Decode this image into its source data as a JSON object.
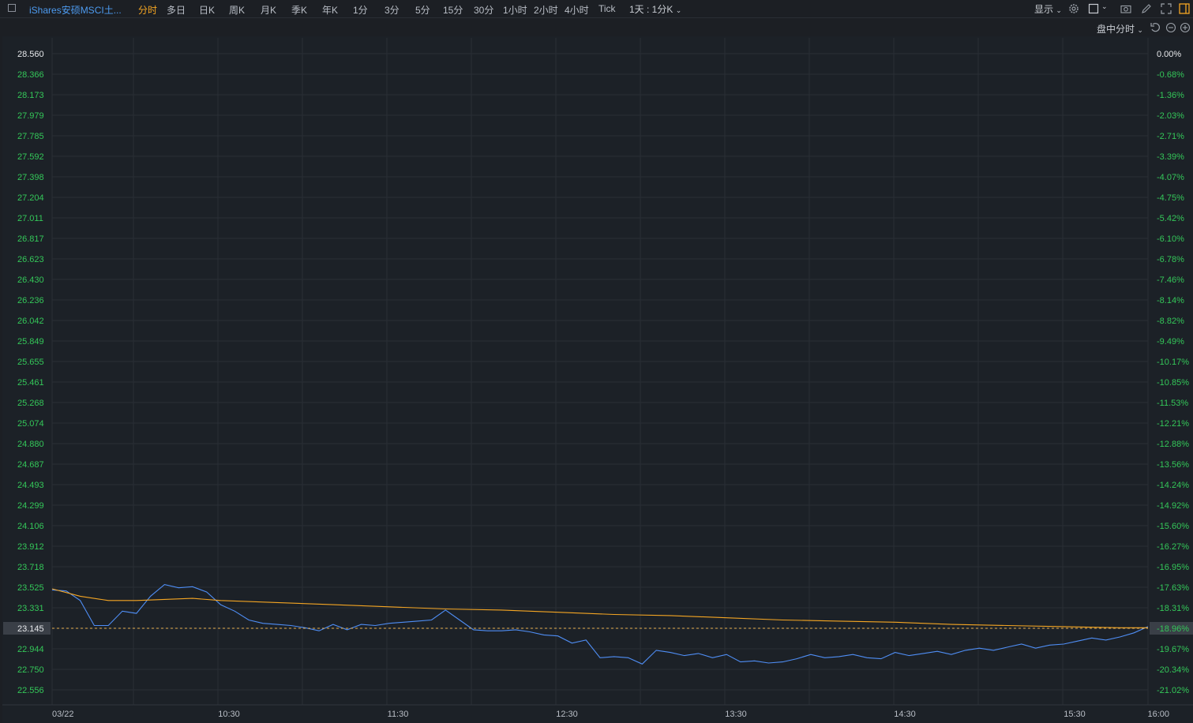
{
  "toolbar": {
    "title": "iShares安硕MSCI土...",
    "timeframes": [
      "分时",
      "多日",
      "日K",
      "周K",
      "月K",
      "季K",
      "年K",
      "1分",
      "3分",
      "5分",
      "15分",
      "30分",
      "1小时",
      "2小时",
      "4小时",
      "Tick"
    ],
    "active_timeframe": "分时",
    "period_select": "1天 : 1分K",
    "display_label": "显示",
    "session_label": "盘中分时"
  },
  "colors": {
    "price_line": "#4f8ef5",
    "avg_line": "#f5a623",
    "left_axis_text": "#34c759",
    "pct_text": "#34c759",
    "current_tag_bg": "#3a3f47",
    "grid": "#2a2e35"
  },
  "chart_data": {
    "type": "line",
    "x_ticks": [
      "03/22",
      "10:30",
      "11:30",
      "12:30",
      "13:30",
      "14:30",
      "15:30",
      "16:00"
    ],
    "y_ticks": [
      "28.560",
      "28.366",
      "28.173",
      "27.979",
      "27.785",
      "27.592",
      "27.398",
      "27.204",
      "27.011",
      "26.817",
      "26.623",
      "26.430",
      "26.236",
      "26.042",
      "25.849",
      "25.655",
      "25.461",
      "25.268",
      "25.074",
      "24.880",
      "24.687",
      "24.493",
      "24.299",
      "24.106",
      "23.912",
      "23.718",
      "23.525",
      "23.331",
      "23.145",
      "22.944",
      "22.750",
      "22.556"
    ],
    "pct_ticks": [
      "0.00%",
      "-0.68%",
      "-1.36%",
      "-2.03%",
      "-2.71%",
      "-3.39%",
      "-4.07%",
      "-4.75%",
      "-5.42%",
      "-6.10%",
      "-6.78%",
      "-7.46%",
      "-8.14%",
      "-8.82%",
      "-9.49%",
      "-10.17%",
      "-10.85%",
      "-11.53%",
      "-12.21%",
      "-12.88%",
      "-13.56%",
      "-14.24%",
      "-14.92%",
      "-15.60%",
      "-16.27%",
      "-16.95%",
      "-17.63%",
      "-18.31%",
      "-18.96%",
      "-19.67%",
      "-20.34%",
      "-21.02%"
    ],
    "ylim": [
      22.556,
      28.56
    ],
    "current_price": "23.145",
    "current_pct": "-18.96%",
    "series": [
      {
        "x": [
          0,
          5,
          10,
          15,
          20,
          25,
          30,
          35,
          40,
          45,
          50,
          55,
          60,
          65,
          70,
          75,
          80,
          85,
          90,
          95,
          100,
          105,
          110,
          115,
          120,
          125,
          130,
          135,
          140,
          145,
          150,
          155,
          160,
          165,
          170,
          175,
          180,
          185,
          190,
          195,
          200,
          205,
          210,
          215,
          220,
          225,
          230,
          235,
          240,
          245,
          250,
          255,
          260,
          265,
          270,
          275,
          280,
          285,
          290,
          295,
          300,
          305,
          310,
          315,
          320,
          325,
          330,
          335,
          340,
          345,
          350,
          355,
          360,
          365,
          370,
          375,
          380,
          385,
          390
        ],
        "values": [
          23.5,
          23.49,
          23.4,
          23.17,
          23.17,
          23.3,
          23.28,
          23.44,
          23.55,
          23.52,
          23.53,
          23.48,
          23.36,
          23.3,
          23.22,
          23.19,
          23.18,
          23.17,
          23.15,
          23.12,
          23.18,
          23.13,
          23.18,
          23.17,
          23.19,
          23.2,
          23.21,
          23.22,
          23.31,
          23.22,
          23.13,
          23.12,
          23.12,
          23.13,
          23.11,
          23.08,
          23.07,
          23.0,
          23.03,
          22.86,
          22.87,
          22.86,
          22.8,
          22.93,
          22.91,
          22.88,
          22.9,
          22.86,
          22.89,
          22.82,
          22.83,
          22.81,
          22.82,
          22.85,
          22.89,
          22.86,
          22.87,
          22.89,
          22.86,
          22.85,
          22.91,
          22.88,
          22.9,
          22.92,
          22.89,
          22.93,
          22.95,
          22.93,
          22.96,
          22.99,
          22.95,
          22.98,
          22.99,
          23.02,
          23.05,
          23.03,
          23.06,
          23.1,
          23.16
        ]
      },
      {
        "x": [
          0,
          10,
          20,
          30,
          40,
          50,
          60,
          80,
          100,
          120,
          140,
          160,
          180,
          200,
          220,
          240,
          260,
          280,
          300,
          320,
          340,
          360,
          380,
          390
        ],
        "values": [
          23.51,
          23.44,
          23.4,
          23.4,
          23.41,
          23.42,
          23.4,
          23.38,
          23.36,
          23.34,
          23.32,
          23.31,
          23.29,
          23.27,
          23.26,
          23.24,
          23.22,
          23.21,
          23.2,
          23.18,
          23.17,
          23.16,
          23.15,
          23.15
        ]
      }
    ]
  }
}
